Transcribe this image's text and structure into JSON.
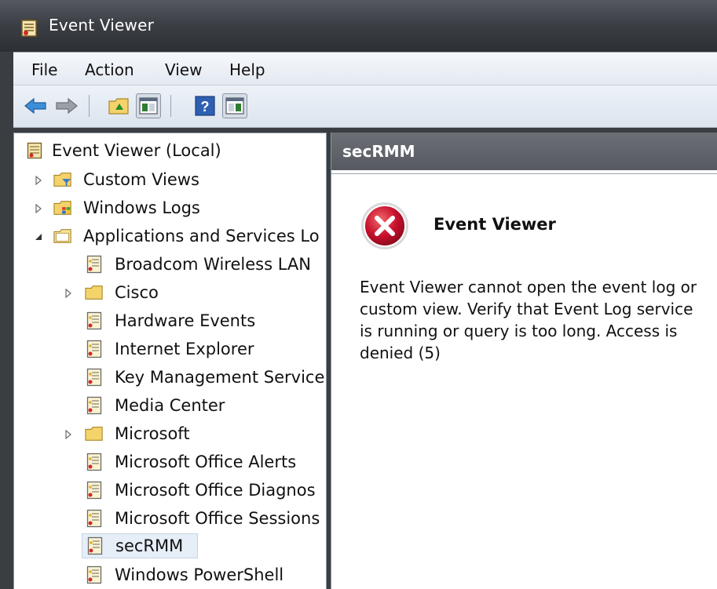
{
  "window": {
    "title": "Event Viewer"
  },
  "menu": [
    "File",
    "Action",
    "View",
    "Help"
  ],
  "toolbar": {
    "buttons": [
      "back-arrow-icon",
      "forward-arrow-icon",
      "up-folder-icon",
      "show-hide-tree-icon",
      "help-icon",
      "show-hide-action-pane-icon"
    ]
  },
  "tree": {
    "root": "Event Viewer (Local)",
    "items": [
      {
        "label": "Custom Views"
      },
      {
        "label": "Windows Logs"
      },
      {
        "label": "Applications and Services Lo"
      },
      {
        "label": "Broadcom Wireless LAN"
      },
      {
        "label": "Cisco"
      },
      {
        "label": "Hardware Events"
      },
      {
        "label": "Internet Explorer"
      },
      {
        "label": "Key Management Service"
      },
      {
        "label": "Media Center"
      },
      {
        "label": "Microsoft"
      },
      {
        "label": "Microsoft Office Alerts"
      },
      {
        "label": "Microsoft Office Diagnos"
      },
      {
        "label": "Microsoft Office Sessions"
      },
      {
        "label": "secRMM"
      },
      {
        "label": "Windows PowerShell"
      }
    ],
    "selected": "secRMM"
  },
  "pane": {
    "header": "secRMM",
    "error_title": "Event Viewer",
    "error_message": "Event Viewer cannot open the event log or custom view. Verify that Event Log service is running or query is too long. Access is denied (5)"
  },
  "colors": {
    "title_bar": "#3c4046",
    "pane_header": "#5f6369",
    "selection": "#e6eef7",
    "error_red": "#c8102e"
  }
}
